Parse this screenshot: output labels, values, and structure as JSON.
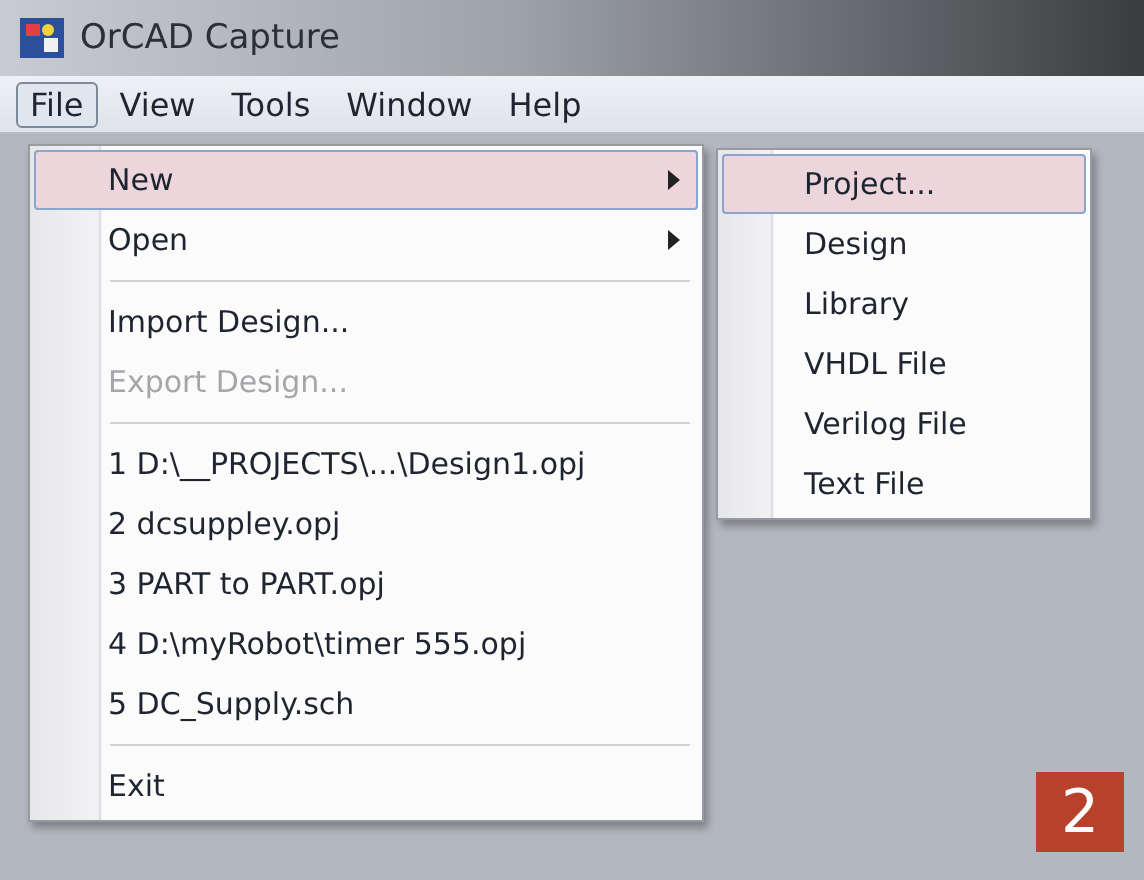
{
  "window": {
    "title": "OrCAD Capture"
  },
  "menu_bar": [
    {
      "label": "File",
      "selected": true
    },
    {
      "label": "View",
      "selected": false
    },
    {
      "label": "Tools",
      "selected": false
    },
    {
      "label": "Window",
      "selected": false
    },
    {
      "label": "Help",
      "selected": false
    }
  ],
  "file_menu": [
    {
      "kind": "item",
      "label": "New",
      "selected": true,
      "disabled": false,
      "submenu": true
    },
    {
      "kind": "item",
      "label": "Open",
      "selected": false,
      "disabled": false,
      "submenu": true
    },
    {
      "kind": "separator"
    },
    {
      "kind": "item",
      "label": "Import Design...",
      "selected": false,
      "disabled": false,
      "submenu": false
    },
    {
      "kind": "item",
      "label": "Export Design...",
      "selected": false,
      "disabled": true,
      "submenu": false
    },
    {
      "kind": "separator"
    },
    {
      "kind": "item",
      "label": "1 D:\\__PROJECTS\\...\\Design1.opj",
      "selected": false,
      "disabled": false,
      "submenu": false
    },
    {
      "kind": "item",
      "label": "2 dcsuppley.opj",
      "selected": false,
      "disabled": false,
      "submenu": false
    },
    {
      "kind": "item",
      "label": "3 PART to PART.opj",
      "selected": false,
      "disabled": false,
      "submenu": false
    },
    {
      "kind": "item",
      "label": "4 D:\\myRobot\\timer 555.opj",
      "selected": false,
      "disabled": false,
      "submenu": false
    },
    {
      "kind": "item",
      "label": "5 DC_Supply.sch",
      "selected": false,
      "disabled": false,
      "submenu": false
    },
    {
      "kind": "separator"
    },
    {
      "kind": "item",
      "label": "Exit",
      "selected": false,
      "disabled": false,
      "submenu": false
    }
  ],
  "new_submenu": [
    {
      "label": "Project...",
      "selected": true
    },
    {
      "label": "Design",
      "selected": false
    },
    {
      "label": "Library",
      "selected": false
    },
    {
      "label": "VHDL File",
      "selected": false
    },
    {
      "label": "Verilog File",
      "selected": false
    },
    {
      "label": "Text File",
      "selected": false
    }
  ],
  "step_badge": "2"
}
